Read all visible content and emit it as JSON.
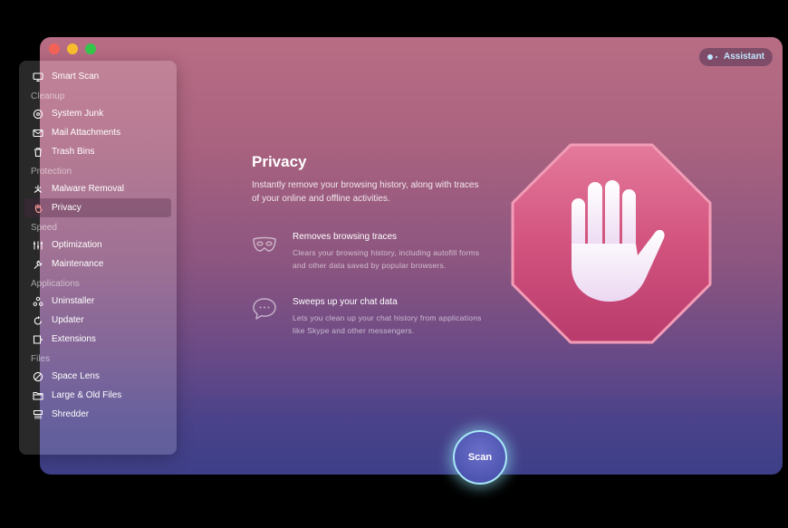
{
  "window": {
    "traffic_lights": [
      "close",
      "minimize",
      "zoom"
    ]
  },
  "assistant": {
    "label": "Assistant"
  },
  "sidebar": {
    "top_item": {
      "label": "Smart Scan",
      "icon": "monitor-icon"
    },
    "sections": [
      {
        "title": "Cleanup",
        "items": [
          {
            "label": "System Junk",
            "icon": "disc-icon"
          },
          {
            "label": "Mail Attachments",
            "icon": "envelope-icon"
          },
          {
            "label": "Trash Bins",
            "icon": "trash-icon"
          }
        ]
      },
      {
        "title": "Protection",
        "items": [
          {
            "label": "Malware Removal",
            "icon": "biohazard-icon"
          },
          {
            "label": "Privacy",
            "icon": "hand-icon",
            "active": true
          }
        ]
      },
      {
        "title": "Speed",
        "items": [
          {
            "label": "Optimization",
            "icon": "sliders-icon"
          },
          {
            "label": "Maintenance",
            "icon": "wrench-icon"
          }
        ]
      },
      {
        "title": "Applications",
        "items": [
          {
            "label": "Uninstaller",
            "icon": "uninstaller-icon"
          },
          {
            "label": "Updater",
            "icon": "updater-icon"
          },
          {
            "label": "Extensions",
            "icon": "extensions-icon"
          }
        ]
      },
      {
        "title": "Files",
        "items": [
          {
            "label": "Space Lens",
            "icon": "lens-icon"
          },
          {
            "label": "Large & Old Files",
            "icon": "folder-icon"
          },
          {
            "label": "Shredder",
            "icon": "shredder-icon"
          }
        ]
      }
    ]
  },
  "main": {
    "title": "Privacy",
    "subtitle": "Instantly remove your browsing history, along with traces of your online and offline activities.",
    "features": [
      {
        "title": "Removes browsing traces",
        "description": "Clears your browsing history, including autofill forms and other data saved by popular browsers.",
        "icon": "mask-icon"
      },
      {
        "title": "Sweeps up your chat data",
        "description": "Lets you clean up your chat history from applications like Skype and other messengers.",
        "icon": "chat-bubble-icon"
      }
    ],
    "hero_icon": "stop-hand-icon"
  },
  "scan": {
    "label": "Scan"
  },
  "colors": {
    "accent": "#a8e8f7",
    "octagon": "#d2537e",
    "traffic_red": "#f26256",
    "traffic_yellow": "#f7bd2f",
    "traffic_green": "#34c64a"
  }
}
